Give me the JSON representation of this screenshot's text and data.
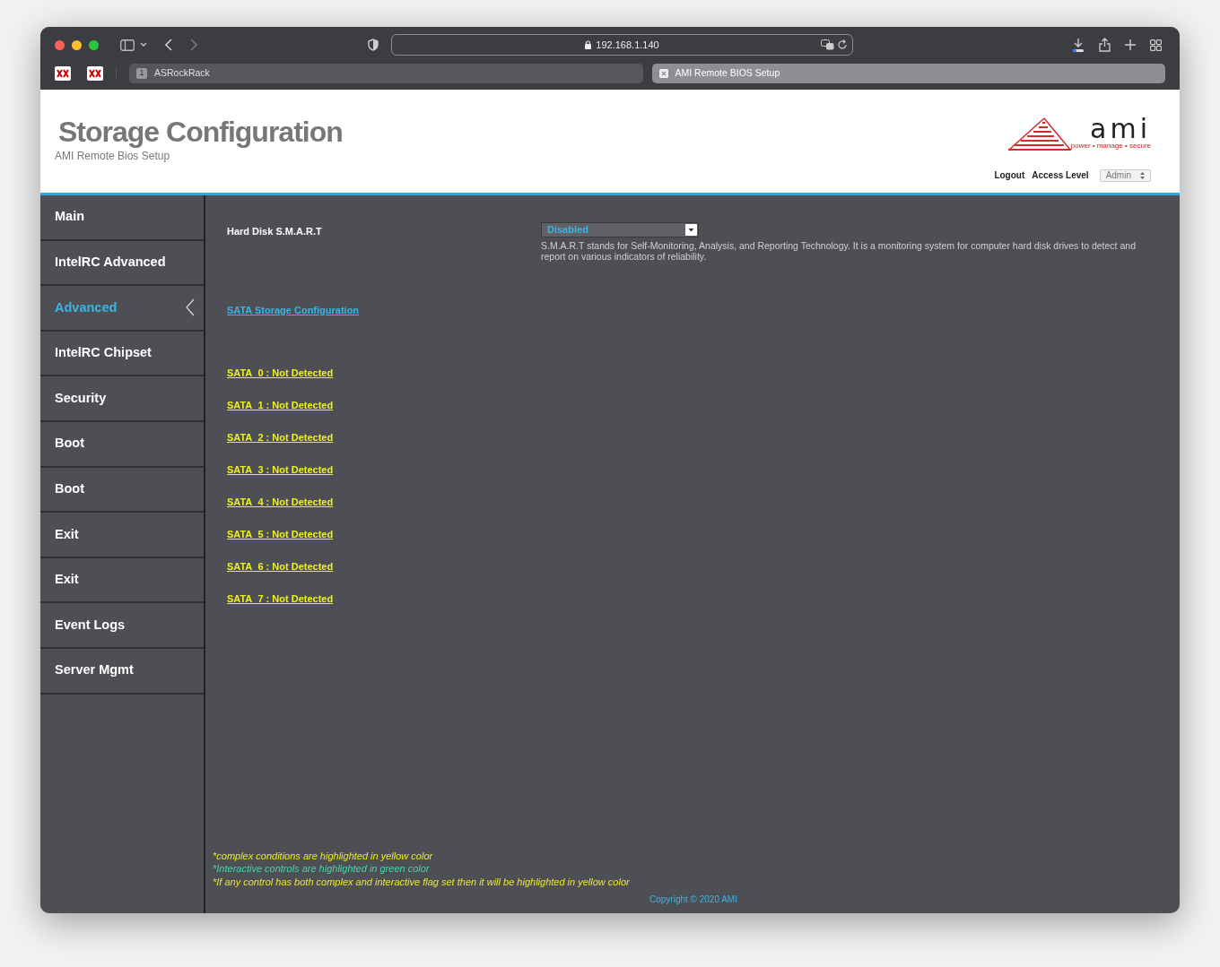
{
  "browser": {
    "url": "192.168.1.140",
    "tabs": [
      {
        "label": "ASRockRack",
        "badge": "1",
        "selected": false
      },
      {
        "label": "AMI Remote BIOS Setup",
        "selected": true
      }
    ]
  },
  "header": {
    "title": "Storage Configuration",
    "subtitle": "AMI Remote Bios Setup",
    "logo_word": "ami",
    "logo_tagline": "power • manage • secure",
    "logout": "Logout",
    "access_level_label": "Access Level",
    "access_level": "Admin"
  },
  "sidebar": {
    "items": [
      {
        "label": "Main",
        "selected": false
      },
      {
        "label": "IntelRC Advanced",
        "selected": false
      },
      {
        "label": "Advanced",
        "selected": true
      },
      {
        "label": "IntelRC Chipset",
        "selected": false
      },
      {
        "label": "Security",
        "selected": false
      },
      {
        "label": "Boot",
        "selected": false
      },
      {
        "label": "Boot",
        "selected": false
      },
      {
        "label": "Exit",
        "selected": false
      },
      {
        "label": "Exit",
        "selected": false
      },
      {
        "label": "Event Logs",
        "selected": false
      },
      {
        "label": "Server Mgmt",
        "selected": false
      }
    ]
  },
  "setting": {
    "label": "Hard Disk S.M.A.R.T",
    "value": "Disabled",
    "help": "S.M.A.R.T stands for Self-Monitoring, Analysis, and Reporting Technology. It is a monitoring system for computer hard disk drives to detect and report on various indicators of reliability."
  },
  "section_link": "SATA Storage Configuration",
  "sata_ports": [
    "SATA_0 : Not Detected",
    "SATA_1 : Not Detected",
    "SATA_2 : Not Detected",
    "SATA_3 : Not Detected",
    "SATA_4 : Not Detected",
    "SATA_5 : Not Detected",
    "SATA_6 : Not Detected",
    "SATA_7 : Not Detected"
  ],
  "notes": [
    {
      "text": "*complex conditions are highlighted in yellow color",
      "color": "#e8e82a"
    },
    {
      "text": "*Interactive controls are highlighted in green color",
      "color": "#3ed8a6"
    },
    {
      "text": "*If any control has both complex and interactive flag set then it will be highlighted in yellow color",
      "color": "#e8e82a"
    }
  ],
  "copyright": "Copyright © 2020 AMI"
}
